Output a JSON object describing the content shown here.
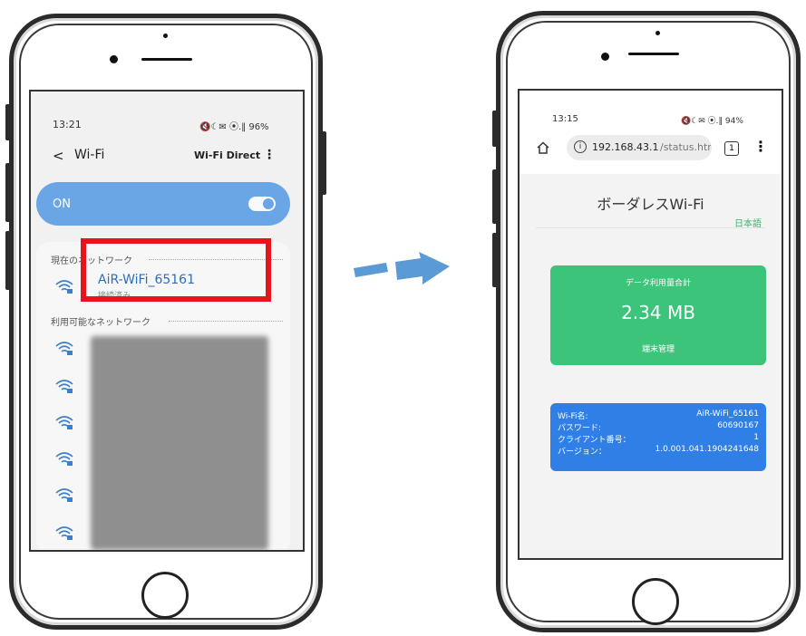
{
  "left_phone": {
    "status_time": "13:21",
    "status_icons": "🔇☾✉ ⦿.‖ 96%",
    "back_label": "<",
    "title": "Wi-Fi",
    "wifi_direct": "Wi-Fi Direct",
    "menu_icon": "⋮",
    "on_label": "ON",
    "current_network_header": "現在のネットワーク",
    "connected_ssid": "AiR-WiFi_65161",
    "connected_status": "接続済み",
    "available_header": "利用可能なネットワーク",
    "accent_color": "#6aa5e6",
    "highlight_color": "#e8141b"
  },
  "right_phone": {
    "status_time": "13:15",
    "status_icons": "🔇☾✉ ⦿.‖ 94%",
    "url_host": "192.168.43.1",
    "url_path": "/status.htr",
    "tab_count": "1",
    "page_title": "ボーダレスWi-Fi",
    "language_link": "日本語",
    "usage_label": "データ利用量合計",
    "usage_value": "2.34 MB",
    "device_mgmt_label": "端末管理",
    "info_rows": [
      {
        "key": "Wi-Fi名:",
        "value": "AiR-WiFi_65161"
      },
      {
        "key": "パスワード:",
        "value": "60690167"
      },
      {
        "key": "クライアント番号：",
        "value": "1"
      },
      {
        "key": "バージョン：",
        "value": "1.0.001.041.1904241648"
      }
    ],
    "green_color": "#3cc47a",
    "blue_color": "#2f7fe6"
  },
  "arrow_color": "#5b9bd5"
}
